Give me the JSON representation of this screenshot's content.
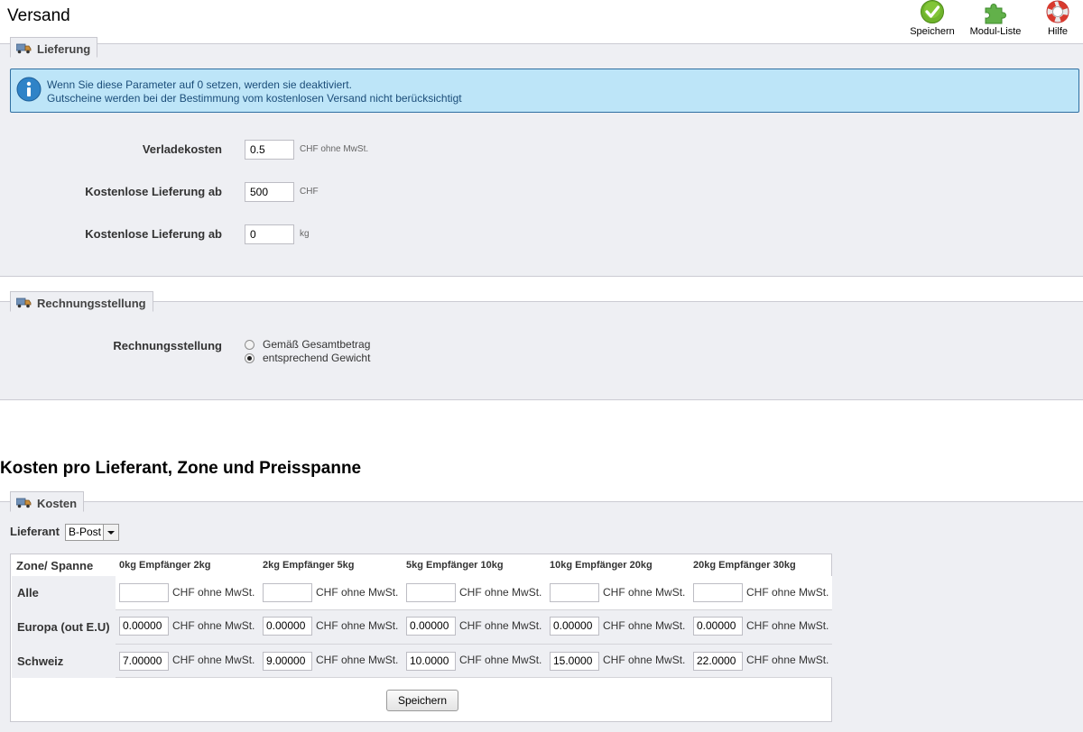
{
  "header": {
    "title": "Versand",
    "toolbar": [
      {
        "label": "Speichern",
        "icon": "check-circle-icon"
      },
      {
        "label": "Modul-Liste",
        "icon": "puzzle-icon"
      },
      {
        "label": "Hilfe",
        "icon": "lifebuoy-icon"
      }
    ]
  },
  "delivery": {
    "legend": "Lieferung",
    "info_line1": "Wenn Sie diese Parameter auf 0 setzen, werden sie deaktiviert.",
    "info_line2": "Gutscheine werden bei der Bestimmung vom kostenlosen Versand nicht berücksichtigt",
    "fields": [
      {
        "label": "Verladekosten",
        "value": "0.5",
        "unit": "CHF ohne MwSt."
      },
      {
        "label": "Kostenlose Lieferung ab",
        "value": "500",
        "unit": "CHF"
      },
      {
        "label": "Kostenlose Lieferung ab",
        "value": "0",
        "unit": "kg"
      }
    ]
  },
  "billing": {
    "legend": "Rechnungsstellung",
    "label": "Rechnungsstellung",
    "options": [
      {
        "label": "Gemäß Gesamtbetrag",
        "selected": false
      },
      {
        "label": "entsprechend Gewicht",
        "selected": true
      }
    ]
  },
  "costs": {
    "section_title": "Kosten pro Lieferant, Zone und Preisspanne",
    "legend": "Kosten",
    "carrier_label": "Lieferant",
    "carrier_value": "B-Post",
    "zone_header": "Zone/ Spanne",
    "ranges": [
      "0kg Empfänger 2kg",
      "2kg Empfänger 5kg",
      "5kg Empfänger 10kg",
      "10kg Empfänger 20kg",
      "20kg Empfänger 30kg"
    ],
    "unit": "CHF ohne MwSt.",
    "rows": [
      {
        "zone": "Alle",
        "values": [
          "",
          "",
          "",
          "",
          ""
        ]
      },
      {
        "zone": "Europa (out E.U)",
        "values": [
          "0.00000",
          "0.00000",
          "0.00000",
          "0.00000",
          "0.00000"
        ]
      },
      {
        "zone": "Schweiz",
        "values": [
          "7.00000",
          "9.00000",
          "10.0000",
          "15.0000",
          "22.0000"
        ]
      }
    ],
    "save_label": "Speichern"
  },
  "colors": {
    "panel_bg": "#eeeff3",
    "info_bg": "#bde5f8",
    "info_border": "#2f6fa1"
  }
}
